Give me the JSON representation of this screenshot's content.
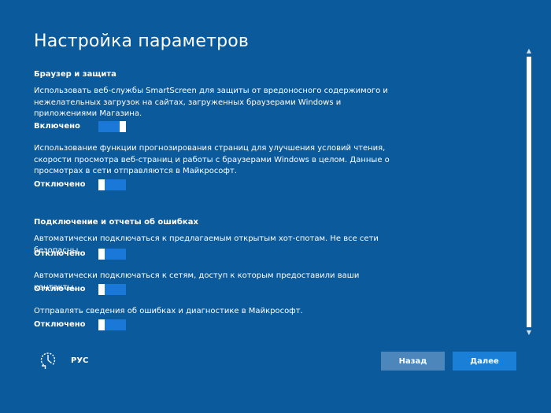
{
  "page": {
    "title": "Настройка параметров"
  },
  "sections": [
    {
      "title": "Браузер и защита",
      "settings": [
        {
          "description": "Использовать веб-службы SmartScreen для защиты от вредоносного содержимого и нежелательных загрузок на сайтах, загруженных браузерами Windows и приложениями Магазина.",
          "state": "Включено",
          "enabled": true
        },
        {
          "description": "Использование функции прогнозирования страниц для улучшения условий чтения, скорости просмотра веб-страниц и работы с браузерами Windows в целом. Данные о просмотрах в сети отправляются в Майкрософт.",
          "state": "Отключено",
          "enabled": false
        }
      ]
    },
    {
      "title": "Подключение и отчеты об ошибках",
      "settings": [
        {
          "description": "Автоматически подключаться к предлагаемым открытым хот-спотам. Не все сети безопасны.",
          "state": "Отключено",
          "enabled": false
        },
        {
          "description": "Автоматически подключаться к сетям, доступ к которым предоставили ваши контакты.",
          "state": "Отключено",
          "enabled": false
        },
        {
          "description": "Отправлять сведения об ошибках и диагностике в Майкрософт.",
          "state": "Отключено",
          "enabled": false
        }
      ]
    }
  ],
  "footer": {
    "ease_of_access_icon": "ease-of-access-icon",
    "language": "РУС",
    "back_label": "Назад",
    "next_label": "Далее"
  },
  "colors": {
    "background": "#0b5a9c",
    "toggle_track": "#1a78d8",
    "back_button": "#4d86ba",
    "next_button": "#1a7fd6"
  }
}
